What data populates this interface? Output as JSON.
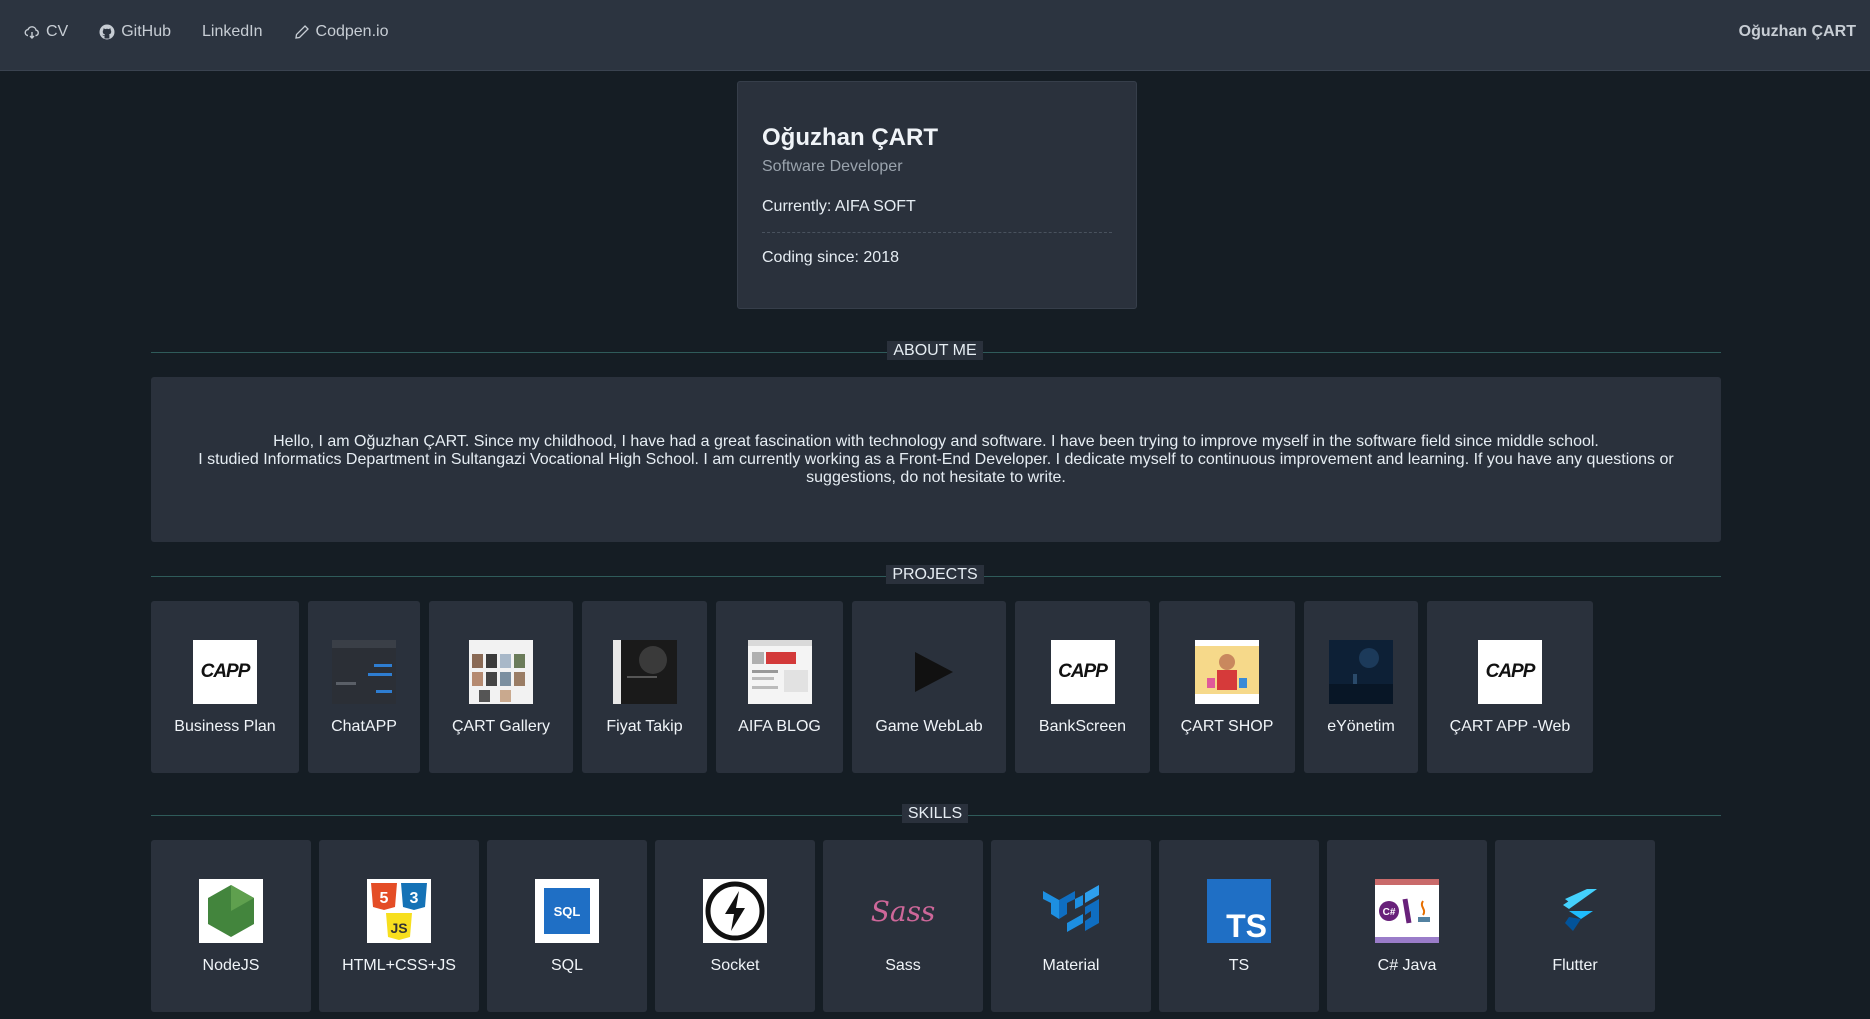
{
  "nav": {
    "items": [
      {
        "label": "CV",
        "icon": "cloud-download-icon"
      },
      {
        "label": "GitHub",
        "icon": "github-icon"
      },
      {
        "label": "LinkedIn",
        "icon": ""
      },
      {
        "label": "Codpen.io",
        "icon": "pencil-icon"
      }
    ],
    "brand": "Oğuzhan ÇART"
  },
  "profile": {
    "name": "Oğuzhan ÇART",
    "title": "Software Developer",
    "currently": "Currently: AIFA SOFT",
    "since": "Coding since: 2018"
  },
  "sections": {
    "about": "ABOUT ME",
    "projects": "PROJECTS",
    "skills": "SKILLS"
  },
  "about": {
    "line1": "Hello, I am Oğuzhan ÇART. Since my childhood, I have had a great fascination with technology and software. I have been trying to improve myself in the software field since middle school.",
    "line2": "I studied Informatics Department in Sultangazi Vocational High School. I am currently working as a Front-End Developer. I dedicate myself to continuous improvement and learning. If you have any questions or suggestions, do not hesitate to write."
  },
  "projects": [
    {
      "label": "Business Plan",
      "thumb": "capp-logo"
    },
    {
      "label": "ChatAPP",
      "thumb": "chat-screenshot"
    },
    {
      "label": "ÇART Gallery",
      "thumb": "gallery-screenshot"
    },
    {
      "label": "Fiyat Takip",
      "thumb": "dark-screenshot"
    },
    {
      "label": "AIFA BLOG",
      "thumb": "blog-screenshot"
    },
    {
      "label": "Game WebLab",
      "thumb": "play-icon"
    },
    {
      "label": "BankScreen",
      "thumb": "capp-logo"
    },
    {
      "label": "ÇART SHOP",
      "thumb": "shop-screenshot"
    },
    {
      "label": "eYönetim",
      "thumb": "night-screenshot"
    },
    {
      "label": "ÇART APP -Web",
      "thumb": "capp-logo"
    }
  ],
  "skills": [
    {
      "label": "NodeJS",
      "icon": "nodejs-icon"
    },
    {
      "label": "HTML+CSS+JS",
      "icon": "html-css-js-icon"
    },
    {
      "label": "SQL",
      "icon": "sql-icon"
    },
    {
      "label": "Socket",
      "icon": "socketio-icon"
    },
    {
      "label": "Sass",
      "icon": "sass-icon"
    },
    {
      "label": "Material",
      "icon": "material-ui-icon"
    },
    {
      "label": "TS",
      "icon": "typescript-icon"
    },
    {
      "label": "C# Java",
      "icon": "csharp-java-icon"
    },
    {
      "label": "Flutter",
      "icon": "flutter-icon"
    }
  ],
  "logo_text": {
    "capp": "CAPP",
    "ts": "TS",
    "sass": "Sass",
    "sql": "SQL"
  },
  "colors": {
    "background": "#151d24",
    "topbar": "#2c3440",
    "card": "#2a313c",
    "divider": "#2f5b5a"
  }
}
